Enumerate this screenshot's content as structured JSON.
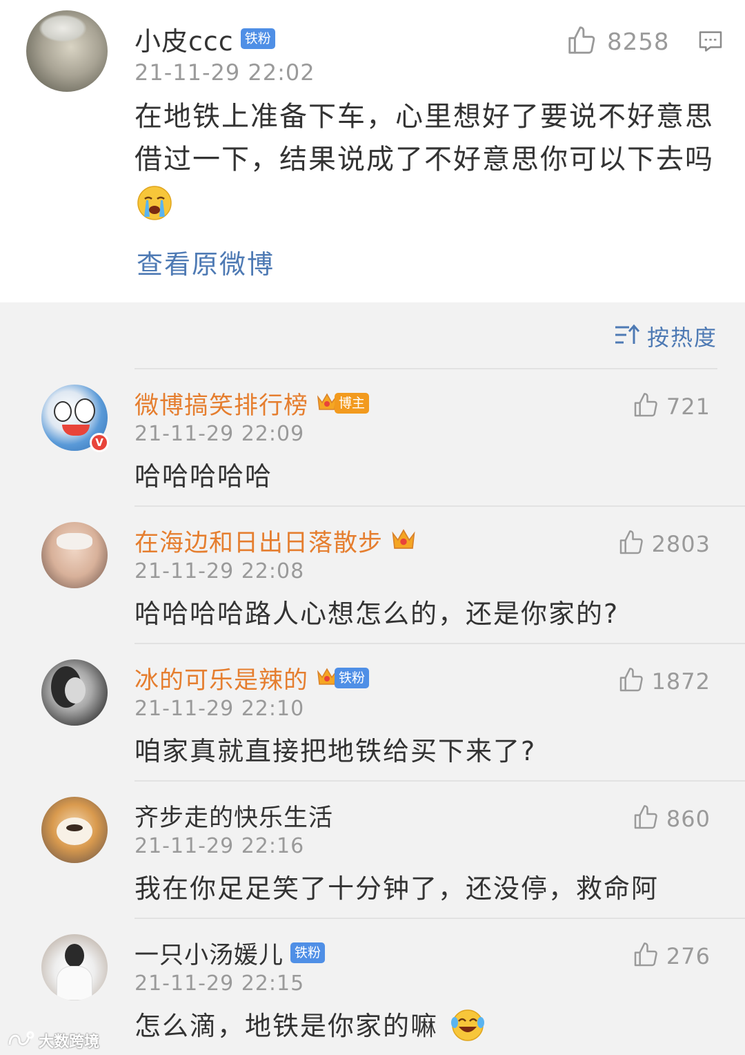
{
  "post": {
    "author": "小皮ccc",
    "badge": "铁粉",
    "time": "21-11-29 22:02",
    "likes": "8258",
    "text": "在地铁上准备下车，心里想好了要说不好意思借过一下，结果说成了不好意思你可以下去吗",
    "emoji": "crying-face",
    "view_original": "查看原微博"
  },
  "sort": {
    "label": "按热度"
  },
  "comments": [
    {
      "name": "微博搞笑排行榜",
      "name_style": "vip",
      "tag": "博主",
      "tag_color": "#f29a1e",
      "time": "21-11-29 22:09",
      "text": "哈哈哈哈哈",
      "likes": "721",
      "verified": "V"
    },
    {
      "name": "在海边和日出日落散步",
      "name_style": "vip",
      "tag": "",
      "time": "21-11-29 22:08",
      "text": "哈哈哈哈路人心想怎么的，还是你家的?",
      "likes": "2803"
    },
    {
      "name": "冰的可乐是辣的",
      "name_style": "vip",
      "tag": "铁粉",
      "tag_color": "#4f8fe6",
      "time": "21-11-29 22:10",
      "text": "咱家真就直接把地铁给买下来了?",
      "likes": "1872"
    },
    {
      "name": "齐步走的快乐生活",
      "name_style": "plain",
      "tag": "",
      "time": "21-11-29 22:16",
      "text": "我在你足足笑了十分钟了，还没停，救命阿",
      "likes": "860"
    },
    {
      "name": "一只小汤媛儿",
      "name_style": "plain",
      "tag": "铁粉",
      "tag_color": "#4f8fe6",
      "time": "21-11-29 22:15",
      "text": "怎么滴，地铁是你家的嘛",
      "likes": "276"
    }
  ],
  "watermark": "大数跨境",
  "colors": {
    "link": "#4e7ab4",
    "vip_name": "#e57e2f",
    "badge_blue": "#4f8fe6",
    "muted": "#9a9a9a"
  }
}
